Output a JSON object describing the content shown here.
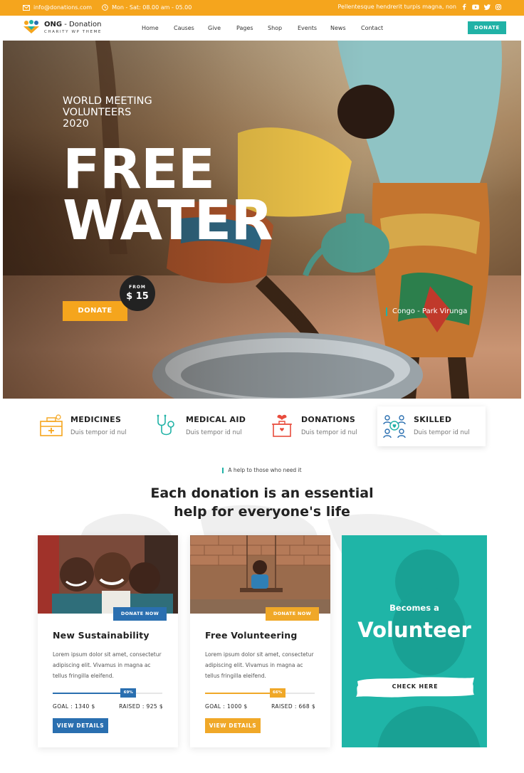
{
  "topbar": {
    "email": "info@donations.com",
    "hours": "Mon - Sat: 08.00 am - 05.00",
    "tagline": "Pellentesque hendrerit turpis magna, non",
    "social_icons": [
      "facebook-icon",
      "youtube-icon",
      "twitter-icon",
      "instagram-icon"
    ]
  },
  "nav": {
    "logo_name_bold": "ONG",
    "logo_name_rest": " - Donation",
    "logo_tagline": "CHARITY WP THEME",
    "menu": [
      "Home",
      "Causes",
      "Give",
      "Pages",
      "Shop",
      "Events",
      "News",
      "Contact"
    ],
    "donate_label": "DONATE"
  },
  "hero": {
    "eyebrow_lines": [
      "WORLD MEETING",
      "VOLUNTEERS",
      "2020"
    ],
    "title_lines": [
      "FREE",
      "WATER"
    ],
    "donate_label": "DONATE",
    "badge_from": "FROM",
    "badge_amount": "$ 15",
    "location": "Congo - Park Virunga"
  },
  "features": [
    {
      "title": "MEDICINES",
      "subtitle": "Duis tempor id nul",
      "icon": "medicine-box-icon",
      "color": "#f5a51d"
    },
    {
      "title": "MEDICAL AID",
      "subtitle": "Duis tempor id nul",
      "icon": "stethoscope-icon",
      "color": "#20b2a6"
    },
    {
      "title": "DONATIONS",
      "subtitle": "Duis tempor id nul",
      "icon": "donation-box-icon",
      "color": "#e84c3d"
    },
    {
      "title": "SKILLED",
      "subtitle": "Duis tempor id nul",
      "icon": "team-icon",
      "color": "#2a6fb0"
    }
  ],
  "section": {
    "kicker": "A help to those who need it",
    "heading_lines": [
      "Each donation is an essential",
      "help for everyone's life"
    ]
  },
  "causes": [
    {
      "tag": "DONATE NOW",
      "title": "New Sustainability",
      "description": "Lorem ipsum dolor sit amet, consectetur adipiscing elit. Vivamus in magna ac tellus fringilla eleifend.",
      "progress": 0.69,
      "progress_label": "69%",
      "goal": "GOAL : 1340 $",
      "raised": "RAISED : 925 $",
      "button": "VIEW DETAILS",
      "accent": "#2a6fb0"
    },
    {
      "tag": "DONATE NOW",
      "title": "Free Volunteering",
      "description": "Lorem ipsum dolor sit amet, consectetur adipiscing elit. Vivamus in magna ac tellus fringilla eleifend.",
      "progress": 0.66,
      "progress_label": "66%",
      "goal": "GOAL : 1000 $",
      "raised": "RAISED : 668 $",
      "button": "VIEW DETAILS",
      "accent": "#f0a828"
    }
  ],
  "volunteer": {
    "small": "Becomes a",
    "big": "Volunteer",
    "cta": "CHECK HERE"
  },
  "colors": {
    "orange": "#f5a51d",
    "teal": "#20b2a6",
    "blue": "#2a6fb0"
  }
}
